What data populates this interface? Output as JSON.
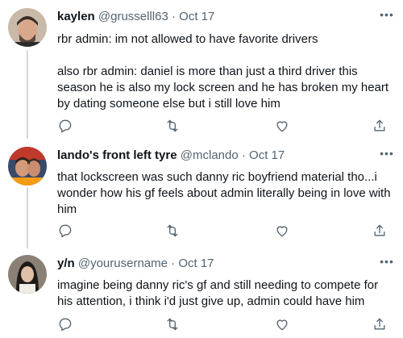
{
  "tweets": [
    {
      "display_name": "kaylen",
      "handle": "@grusselll63",
      "separator": "·",
      "date": "Oct 17",
      "more_label": "•••",
      "body": "rbr admin: im not allowed to have favorite drivers\n\nalso rbr admin: daniel is more than just a third driver this season he is also my lock screen and he has broken my heart by dating someone else but i still love him",
      "avatar_colors": {
        "bg": "#c9b9a8",
        "skin": "#d9a78b",
        "hair": "#3b2e26"
      }
    },
    {
      "display_name": "lando's front left tyre",
      "handle": "@mclando",
      "separator": "·",
      "date": "Oct 17",
      "more_label": "•••",
      "body": "that lockscreen was such danny ric boyfriend material tho...i wonder how his gf feels about admin literally being in love with him",
      "avatar_colors": {
        "bg": "#3a4a6b",
        "skin": "#d39a7a",
        "hair": "#2a211c"
      }
    },
    {
      "display_name": "y/n",
      "handle": "@yourusername",
      "separator": "·",
      "date": "Oct 17",
      "more_label": "•••",
      "body": "imagine being danny ric's gf and still needing to compete for his attention, i think i'd just give up, admin could have him",
      "avatar_colors": {
        "bg": "#8a8075",
        "skin": "#e0c0a8",
        "hair": "#1e1a17"
      }
    }
  ],
  "icons": [
    "reply-icon",
    "retweet-icon",
    "like-icon",
    "share-icon"
  ],
  "colors": {
    "text": "#0f1419",
    "muted": "#536471",
    "thread_line": "#cfd9de"
  }
}
